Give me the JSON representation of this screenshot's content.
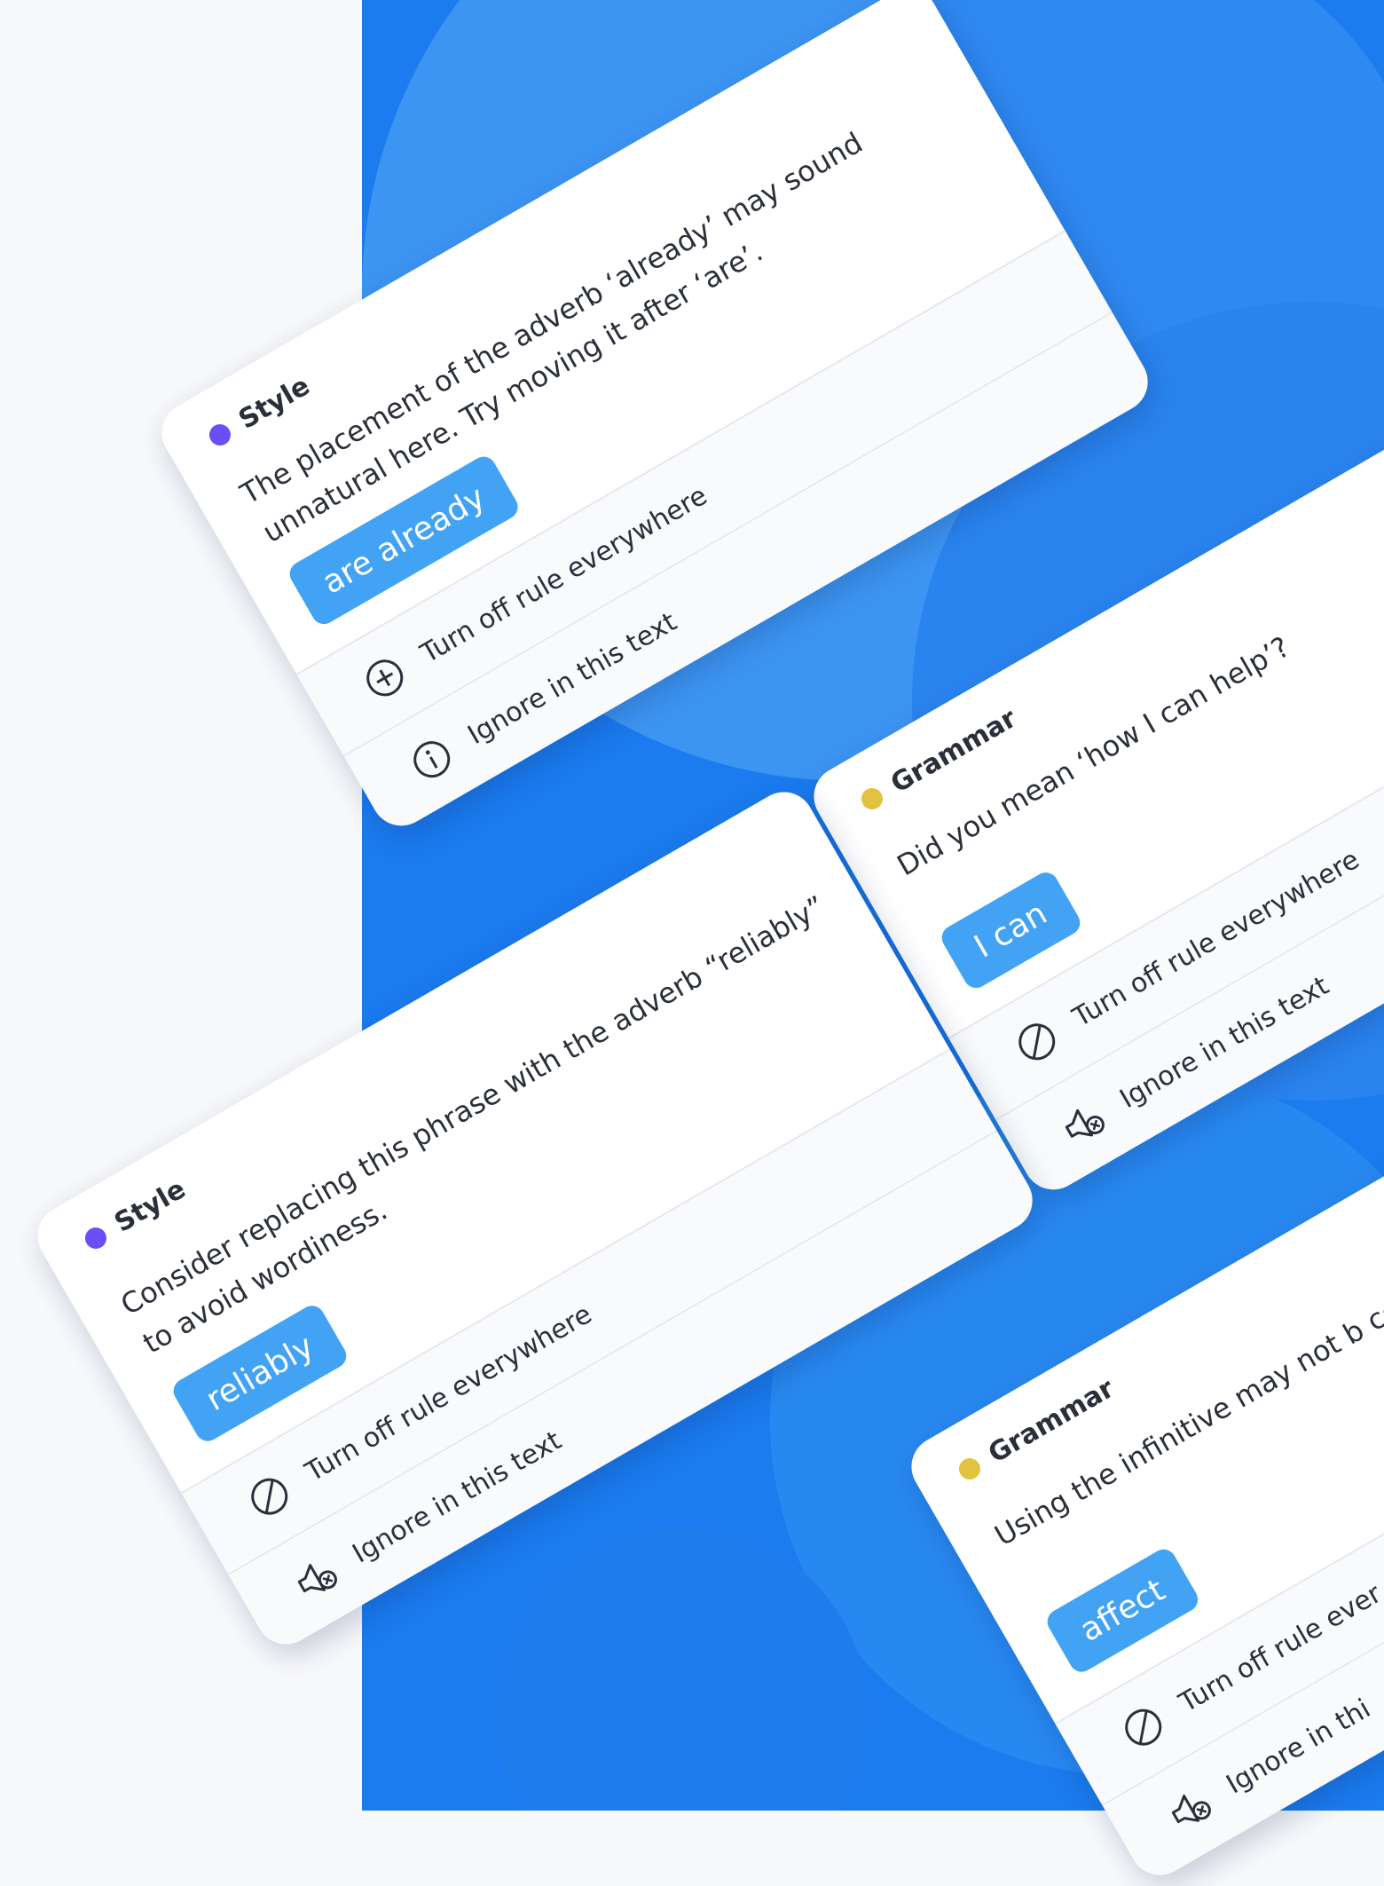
{
  "cards": [
    {
      "category": "Style",
      "category_color": "#6b4ef6",
      "message": "The placement of the adverb ‘already’ may sound unnatural here. Try moving it after ‘are’.",
      "suggestion": "are already",
      "actions": [
        {
          "label": "Turn off rule everywhere",
          "icon": "add-circle-icon"
        },
        {
          "label": "Ignore in this text",
          "icon": "info-circle-icon"
        }
      ]
    },
    {
      "category": "Grammar",
      "category_color": "#e2c33f",
      "message": "Did you mean ‘how I can help’?",
      "suggestion": "I can",
      "actions": [
        {
          "label": "Turn off rule everywhere",
          "icon": "disable-icon"
        },
        {
          "label": "Ignore in this text",
          "icon": "mute-icon"
        }
      ]
    },
    {
      "category": "Style",
      "category_color": "#6b4ef6",
      "message": "Consider replacing this phrase with the adverb “reliably” to avoid wordiness.",
      "suggestion": "reliably",
      "actions": [
        {
          "label": "Turn off rule everywhere",
          "icon": "disable-icon"
        },
        {
          "label": "Ignore in this text",
          "icon": "mute-icon"
        }
      ]
    },
    {
      "category": "Grammar",
      "category_color": "#e2c33f",
      "message": "Using the infinitive may not b context",
      "suggestion": "affect",
      "actions": [
        {
          "label": "Turn off rule ever",
          "icon": "disable-icon"
        },
        {
          "label": "Ignore in thi",
          "icon": "mute-icon"
        }
      ]
    }
  ]
}
